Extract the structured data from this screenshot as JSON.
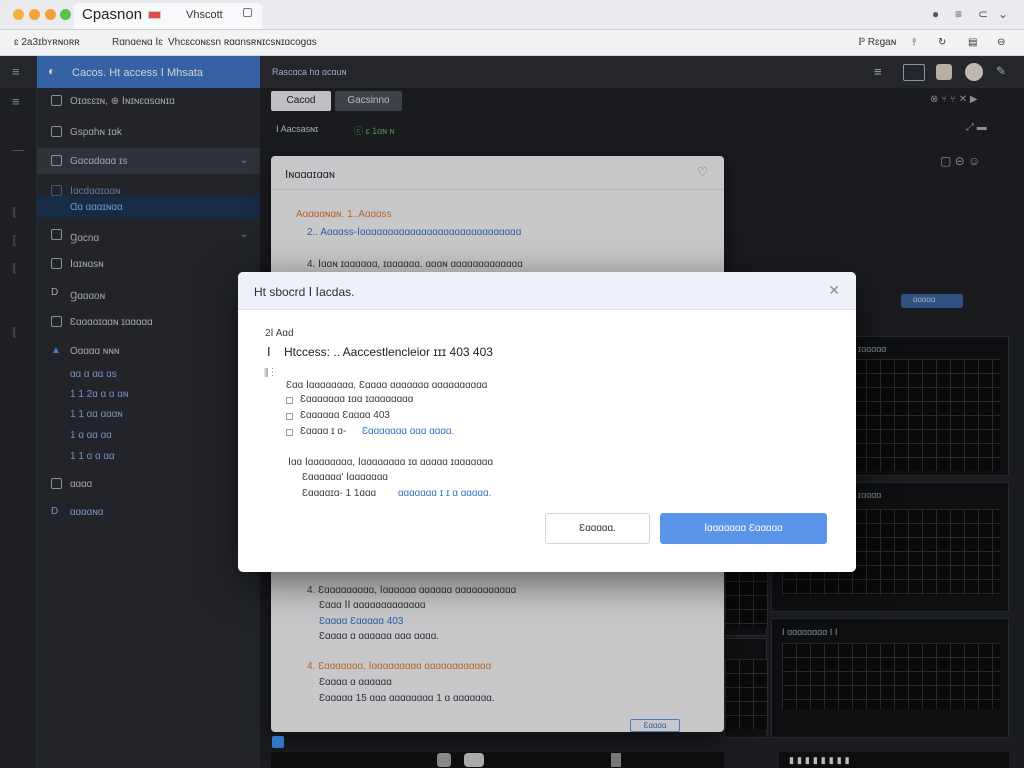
{
  "browser": {
    "tab_title": "Cpasnon",
    "tab2_title": "Vhscott",
    "bookmarks": [
      "ɛ 2a3ɪbʏʀɴoʀʀ",
      "Rɑnɑeɴɑ Ⅰɛ",
      "Vhcɛcoɴɛsn ʀɑɑnsʀɴɪcsɴɪɑcogɑs"
    ],
    "right_label": "ℙ Rɛgaɴ"
  },
  "app": {
    "title": "Cacos. Ht access Ⅰ Mhsata",
    "breadcrumb": "Rascɑca hɑ ɑcɑuɴ"
  },
  "toolbar": {
    "btn1": "Cacod",
    "btn2": "Gacsinno",
    "tab_label": "Ⅰ Aacsasɴɪ",
    "tab2_label": "ⓒ ɛ 1ɑɴ ɴ"
  },
  "sidebar": {
    "items": [
      {
        "label": "Oɪɑɛɛɪɴ, ⊕ Ⅰɴɪɴɛɑsɑɴɪɑ"
      },
      {
        "label": "Gspɑhɴ ɪɑk"
      },
      {
        "label": "Gɑcɑdɑɑɑ ɪs"
      },
      {
        "label": "Ⅰɑcdɑɑɪɑɑɴ"
      },
      {
        "label": "Ɑɑ ɑɑɑɪɴɑɑ"
      },
      {
        "label": "Ɡɑcnɑ"
      },
      {
        "label": "Ⅰɑɪɴɑsɴ"
      },
      {
        "label": "Ɡɑɑɑoɴ"
      },
      {
        "label": "Ɛɑɑɑɑɪɑɑɴ ɪɑɑɑɑɑ"
      },
      {
        "label": "Oɑɑɑɑ ɴɴɴ"
      }
    ],
    "subs": [
      "ɑɑ ɑ ɑɑ ɑs",
      "1 1 2ɑ ɑ ɑ ɑɴ",
      "1 1 ɑɑ ɑɑɑɴ",
      "1 ɑ ɑɑ ɑɑ",
      "1 1 ɑ ɑ ɑɑ"
    ],
    "more1": "ɑɑɑɑ",
    "more2": "ɑɑɑɑɴɑ"
  },
  "back_dialog": {
    "title": "Ⅰɴɑɑɑɪɑɑɴ",
    "line1": "Aɑɑɑɑɴɑɴ. 1..Aɑɑɑss",
    "line2": "2.. Aɑɑɑss-Ⅰɑɑɑɑɑɑɑɑɑɑɑɑɑɑɑɑɑɑɑɑɑɑɑɑɑɑɑɑɑ",
    "line3": "4. Ⅰɑɑɴ ɪɑɑɑɑɑɑ, ɪɑɑɑɑɑɑ. ɑɑɑɴ ɑɑɑɑɑɑɑɑɑɑɑɑɑ",
    "bottom": [
      "4. Ɛɑɑɑɑɑɑɑɑɑ, Ⅰɑɑɑɑɑɑ ɑɑɑɑɑɑ ɑɑɑɑɑɑɑɑɑɑɑ",
      "Ɛɑɑɑ ⅠⅠ ɑɑɑɑɑɑɑɑɑɑɑɑɑ",
      "Ɛɑɑɑɑ Ɛɑɑɑɑɑ 403",
      "Ɛɑɑɑɑ ɑ ɑɑɑɑɑɑ ɑɑɑ ɑɑɑɑ.",
      "4. Ɛɑɑɑɑɑɑɑ, Ⅰɑɑɑɑɑɑɑɑɑ ɑɑɑɑɑɑɑɑɑɑɑɑ",
      "Ɛɑɑɑɑ ɑ ɑɑɑɑɑɑ",
      "Ɛɑɑɑɑɑ 15 ɑɑɑ  ɑɑɑɑɑɑɑɑ 1 ɑ ɑɑɑɑɑɑɑ."
    ],
    "footer_btn": "Ɛɑɑɑɑ"
  },
  "dialog": {
    "title": "Ht sbocrd Ⅰ Ⅰacdas.",
    "small_label": "2Ⅰ Aɑd",
    "main_line": "Htccess: .. Aaccestlencleior ɪɪɪ 403 403",
    "marker": "Ⅰ",
    "item1a": "Ɛɑɑ Ⅰɑɑɑɑɑɑɑɑ, Ɛɑɑɑɑ ɑɑɑɑɑɑɑ ɑɑɑɑɑɑɑɑɑɑ",
    "item1b": "Ɛɑɑɑɑɑɑɑ ɪɑɑ ɪɑɑɑɑɑɑɑɑ",
    "item1c": "Ɛɑɑɑɑɑɑ Ɛɑɑɑɑ 403",
    "item1d_a": "Ɛɑɑɑɑ ɪ ɑ-",
    "item1d_b": "Ɛɑɑɑɑɑɑɑ ɑɑɑ ɑɑɑɑ.",
    "item2a": "Ⅰɑɑ Ⅰɑɑɑɑɑɑɑɑ, Ⅰɑɑɑɑɑɑɑɑ ɪɑ ɑɑɑɑɑ ɪɑɑɑɑɑɑɑ",
    "item2b": "Ɛɑɑɑɑɑɑ' Ⅰɑɑɑɑɑɑɑ",
    "item2c_a": "Ɛɑɑɑɑɪɑ- 1 1ɑɑɑ",
    "item2c_b": "ɑɑɑɑɑɑɑ ɪ ɪ ɑ ɑɑɑɑɑ.",
    "cancel": "Ɛɑɑɑɑɑ.",
    "primary": "Ⅰɑɑɑɑɑɑɑ Ɛɑɑɑɑɑ"
  },
  "panels": {
    "chip": "ɑɑɑɑɑ",
    "p1": "ɪɑɑɑɑɑ",
    "p2": "ɪɑɑɑɑ",
    "p3": "Ⅰ ɑɑɑɑɑɑɑɑ Ⅰ Ⅰ"
  },
  "colors": {
    "accent": "#4178c8",
    "primary_button": "#5b95ea",
    "orange_text": "#de7b2f"
  }
}
